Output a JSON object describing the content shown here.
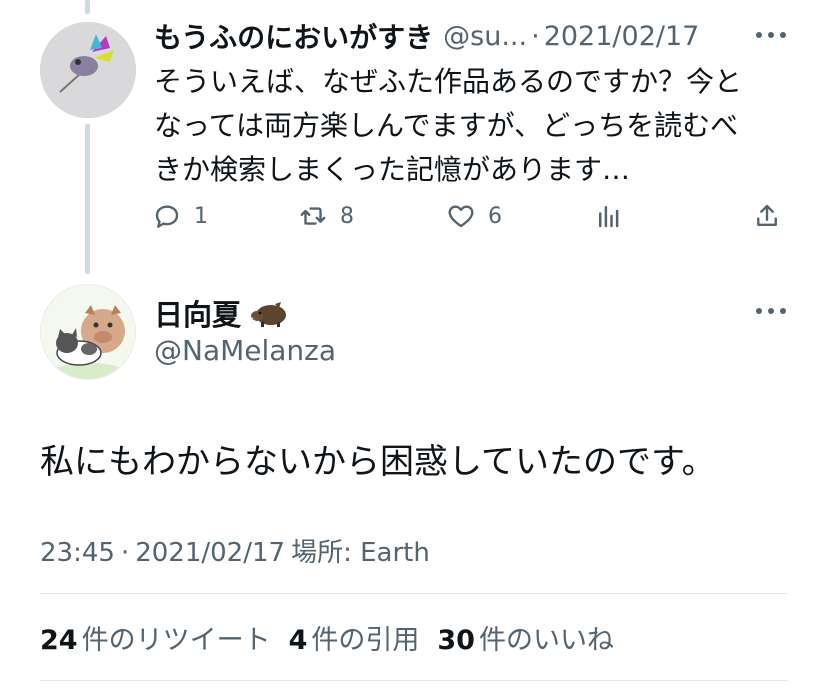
{
  "reply_tweet": {
    "display_name": "もうふのにおいがすき",
    "handle": "@su...",
    "separator": "·",
    "date": "2021/02/17",
    "text": "そういえば、なぜふた作品あるのですか？今となっては両方楽しんでますが、どっちを読むべきか検索しまくった記憶があります…",
    "reply_count": "1",
    "retweet_count": "8",
    "like_count": "6"
  },
  "main_tweet": {
    "display_name": "日向夏",
    "name_emoji_icon": "boar-icon",
    "handle": "@NaMelanza",
    "text": "私にもわからないから困惑していたのです。",
    "time": "23:45",
    "separator": "·",
    "date": "2021/02/17",
    "location": "場所: Earth"
  },
  "engagement": {
    "retweets_number": "24",
    "retweets_label": "件のリツイート",
    "quotes_number": "4",
    "quotes_label": "件の引用",
    "likes_number": "30",
    "likes_label": "件のいいね"
  },
  "colors": {
    "text_primary": "#0f1419",
    "text_secondary": "#536471",
    "thread_line": "#cfd9de",
    "divider": "#e1e7ea"
  }
}
